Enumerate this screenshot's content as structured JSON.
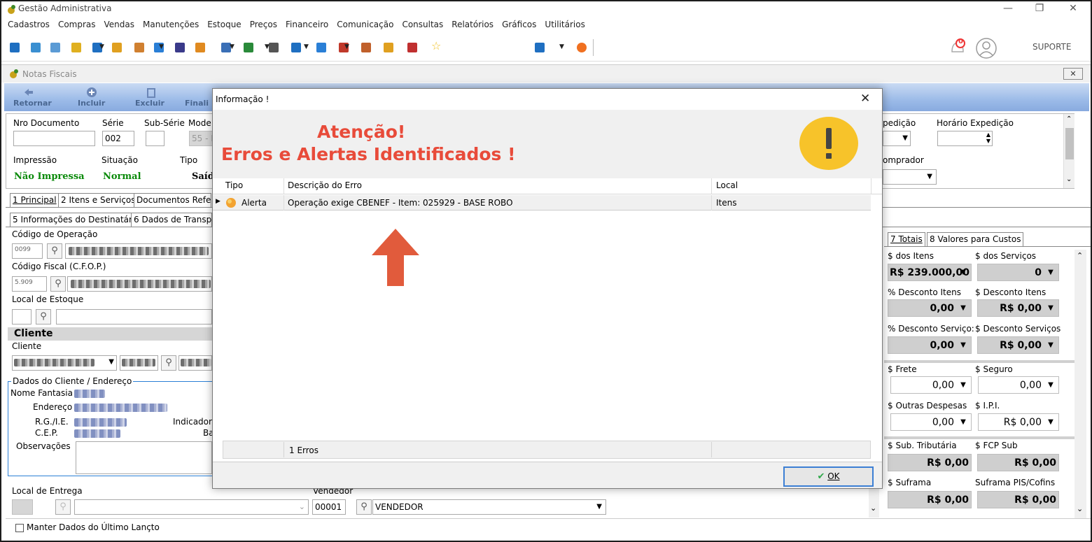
{
  "app": {
    "title": "Gestão Administrativa",
    "menu": [
      "Cadastros",
      "Compras",
      "Vendas",
      "Manutenções",
      "Estoque",
      "Preços",
      "Financeiro",
      "Comunicação",
      "Consultas",
      "Relatórios",
      "Gráficos",
      "Utilitários"
    ],
    "notification_count": "0",
    "user": "SUPORTE"
  },
  "inner": {
    "title": "Notas Fiscais",
    "toolbar": [
      "Retornar",
      "Incluir",
      "Excluir",
      "Finali"
    ]
  },
  "form": {
    "nro_documento_label": "Nro Documento",
    "serie_label": "Série",
    "serie_value": "002",
    "subserie_label": "Sub-Série",
    "modelo_label": "Mode",
    "modelo_value": "55 - I",
    "impressao_label": "Impressão",
    "impressao_value": "Não Impressa",
    "situacao_label": "Situação",
    "situacao_value": "Normal",
    "tipo_label": "Tipo",
    "tipo_value": "Saíd",
    "expedicao_label": "pedição",
    "horario_expedicao_label": "Horário Expedição",
    "comprador_label": "omprador"
  },
  "tabs_main": [
    "1 Principal",
    "2 Itens e Serviços",
    "Documentos Refere"
  ],
  "tabs_sub": [
    "5 Informações do Destinatário",
    "6 Dados de Transpo"
  ],
  "left": {
    "codigo_operacao_label": "Código de Operação",
    "codigo_operacao_value": "0099",
    "codigo_fiscal_label": "Código Fiscal (C.F.O.P.)",
    "codigo_fiscal_value": "5.909",
    "local_estoque_label": "Local de Estoque",
    "cliente_section": "Cliente",
    "cliente_label": "Cliente",
    "dados_cliente_legend": "Dados do Cliente / Endereço",
    "nome_fantasia_label": "Nome Fantasia",
    "endereco_label": "Endereço",
    "rgie_label": "R.G./I.E.",
    "indicador_label": "Indicador",
    "cep_label": "C.E.P.",
    "ba_label": "Ba",
    "observacoes_label": "Observações",
    "local_entrega_label": "Local de Entrega",
    "vendedor_label": "Vendedor",
    "vendedor_code": "00001",
    "vendedor_name": "VENDEDOR",
    "manter_dados_label": "Manter Dados do Último Lançto"
  },
  "right": {
    "tabs": [
      "7 Totais",
      "8 Valores para Custos"
    ],
    "dos_itens_label": "$ dos Itens",
    "dos_itens_value": "R$ 239.000,00",
    "dos_servicos_label": "$ dos Serviços",
    "dos_servicos_value": "0",
    "desc_itens_pct_label": "% Desconto Itens",
    "desc_itens_pct_value": "0,00",
    "desc_itens_label": "$ Desconto Itens",
    "desc_itens_value": "R$ 0,00",
    "desc_serv_pct_label": "% Desconto Serviço:",
    "desc_serv_pct_value": "0,00",
    "desc_serv_label": "$ Desconto Serviços",
    "desc_serv_value": "R$ 0,00",
    "frete_label": "$ Frete",
    "frete_value": "0,00",
    "seguro_label": "$ Seguro",
    "seguro_value": "0,00",
    "outras_label": "$ Outras Despesas",
    "outras_value": "0,00",
    "ipi_label": "$ I.P.I.",
    "ipi_value": "R$ 0,00",
    "sub_trib_label": "$ Sub. Tributária",
    "sub_trib_value": "R$ 0,00",
    "fcp_sub_label": "$ FCP Sub",
    "fcp_sub_value": "R$ 0,00",
    "suframa_label": "$ Suframa",
    "suframa_value": "R$ 0,00",
    "suframa_pis_label": "Suframa PIS/Cofins",
    "suframa_pis_value": "R$ 0,00"
  },
  "dialog": {
    "title": "Informação !",
    "heading1": "Atenção!",
    "heading2": "Erros e Alertas Identificados !",
    "columns": [
      "Tipo",
      "Descrição do Erro",
      "Local"
    ],
    "rows": [
      {
        "tipo": "Alerta",
        "descricao": "Operação exige CBENEF - Item: 025929 - BASE ROBO",
        "local": "Itens"
      }
    ],
    "footer_count": "1 Erros",
    "ok_label": "OK"
  }
}
